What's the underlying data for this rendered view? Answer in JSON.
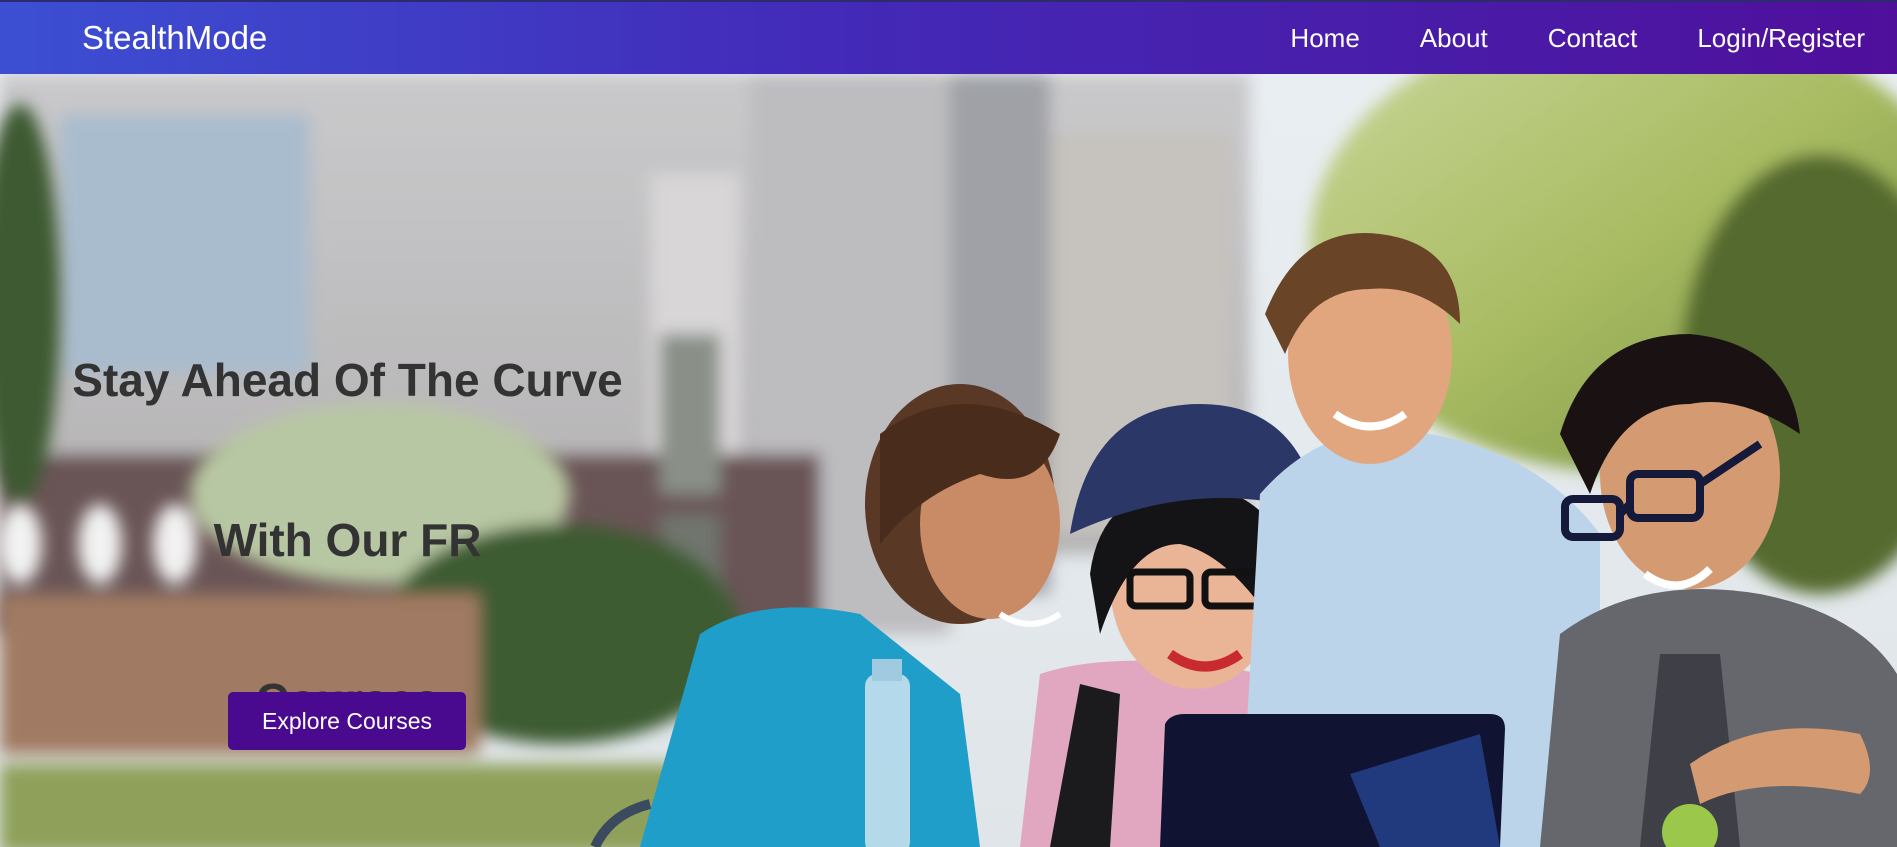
{
  "navbar": {
    "brand": "StealthMode",
    "links": [
      "Home",
      "About",
      "Contact",
      "Login/Register"
    ]
  },
  "hero": {
    "title_lines": [
      "Stay Ahead Of The Curve",
      "With Our FR",
      "Courses"
    ],
    "button_label": "Explore Courses",
    "image_description_icon": "students-laptop-photo"
  },
  "colors": {
    "nav_gradient_start": "#3c4fd3",
    "nav_gradient_end": "#4f0f9b",
    "button_bg": "#4a0a8f",
    "title_text": "#333333"
  }
}
